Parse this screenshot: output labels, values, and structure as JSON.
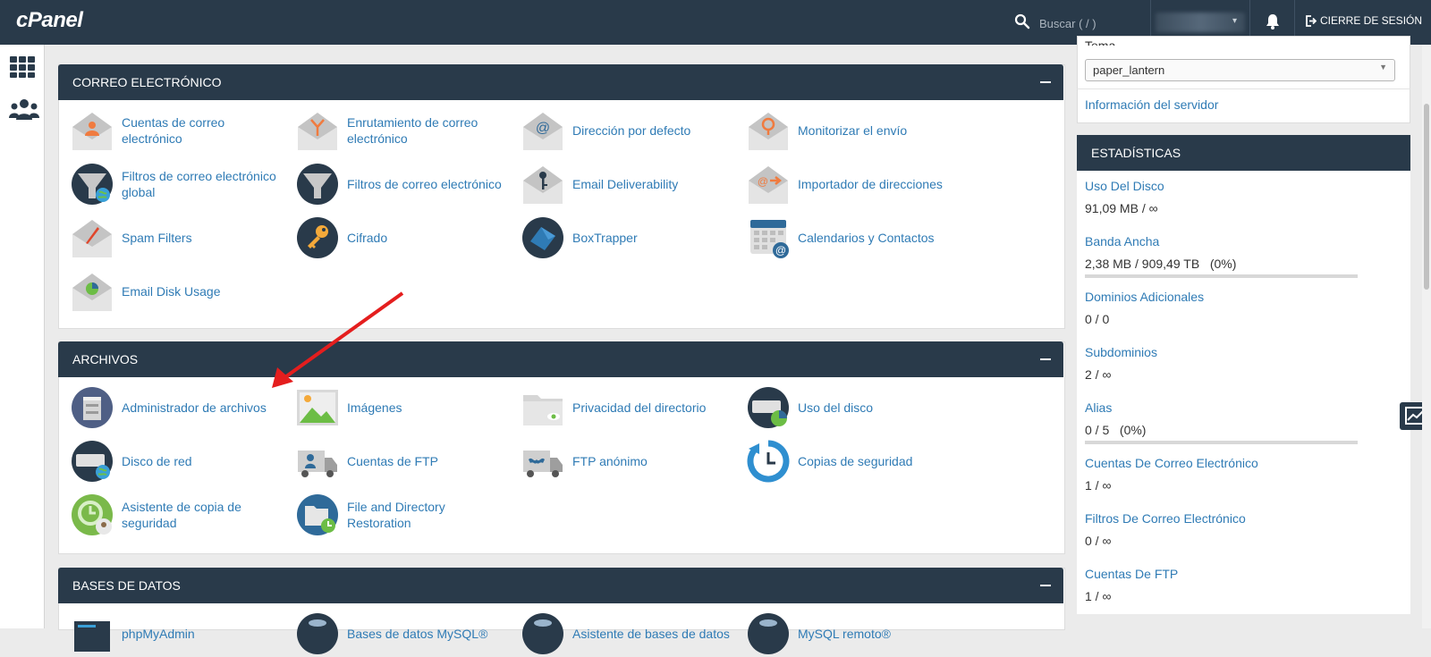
{
  "app": {
    "logo": "cPanel"
  },
  "topbar": {
    "search_placeholder": "Buscar ( / )",
    "logout_label": "CIERRE DE SESIÓN"
  },
  "sections": [
    {
      "title": "CORREO ELECTRÓNICO",
      "items": [
        {
          "label": "Cuentas de correo electrónico",
          "icon": "email-accounts-icon"
        },
        {
          "label": "Enrutamiento de correo electrónico",
          "icon": "email-routing-icon"
        },
        {
          "label": "Dirección por defecto",
          "icon": "default-address-icon"
        },
        {
          "label": "Monitorizar el envío",
          "icon": "track-delivery-icon"
        },
        {
          "label": "Filtros de correo electrónico global",
          "icon": "global-filter-icon"
        },
        {
          "label": "Filtros de correo electrónico",
          "icon": "email-filter-icon"
        },
        {
          "label": "Email Deliverability",
          "icon": "deliverability-icon"
        },
        {
          "label": "Importador de direcciones",
          "icon": "address-importer-icon"
        },
        {
          "label": "Spam Filters",
          "icon": "spam-filter-icon"
        },
        {
          "label": "Cifrado",
          "icon": "encryption-key-icon"
        },
        {
          "label": "BoxTrapper",
          "icon": "boxtrapper-icon"
        },
        {
          "label": "Calendarios y Contactos",
          "icon": "calendar-icon"
        },
        {
          "label": "Email Disk Usage",
          "icon": "email-disk-usage-icon"
        }
      ]
    },
    {
      "title": "ARCHIVOS",
      "items": [
        {
          "label": "Administrador de archivos",
          "icon": "file-manager-icon"
        },
        {
          "label": "Imágenes",
          "icon": "images-icon"
        },
        {
          "label": "Privacidad del directorio",
          "icon": "directory-privacy-icon"
        },
        {
          "label": "Uso del disco",
          "icon": "disk-usage-icon"
        },
        {
          "label": "Disco de red",
          "icon": "network-disk-icon"
        },
        {
          "label": "Cuentas de FTP",
          "icon": "ftp-accounts-icon"
        },
        {
          "label": "FTP anónimo",
          "icon": "anonymous-ftp-icon"
        },
        {
          "label": "Copias de seguridad",
          "icon": "backup-icon"
        },
        {
          "label": "Asistente de copia de seguridad",
          "icon": "backup-wizard-icon"
        },
        {
          "label": "File and Directory Restoration",
          "icon": "restoration-icon"
        }
      ]
    },
    {
      "title": "BASES DE DATOS",
      "items": [
        {
          "label": "phpMyAdmin",
          "icon": "phpmyadmin-icon"
        },
        {
          "label": "Bases de datos MySQL®",
          "icon": "mysql-database-icon"
        },
        {
          "label": "Asistente de bases de datos",
          "icon": "database-wizard-icon"
        },
        {
          "label": "MySQL remoto®",
          "icon": "remote-mysql-icon"
        }
      ]
    }
  ],
  "general": {
    "theme_label": "Tema",
    "theme_value": "paper_lantern",
    "server_info": "Información del servidor"
  },
  "statistics": {
    "title": "ESTADÍSTICAS",
    "items": [
      {
        "name": "Uso Del Disco",
        "value": "91,09 MB / ∞"
      },
      {
        "name": "Banda Ancha",
        "value": "2,38 MB / 909,49 TB   (0%)",
        "usage_fraction": 0
      },
      {
        "name": "Dominios Adicionales",
        "value": "0 / 0"
      },
      {
        "name": "Subdominios",
        "value": "2 / ∞"
      },
      {
        "name": "Alias",
        "value": "0 / 5   (0%)",
        "usage_fraction": 0
      },
      {
        "name": "Cuentas De Correo Electrónico",
        "value": "1 / ∞"
      },
      {
        "name": "Filtros De Correo Electrónico",
        "value": "0 / ∞"
      },
      {
        "name": "Cuentas De FTP",
        "value": "1 / ∞"
      }
    ]
  },
  "colors": {
    "header": "#293a4a",
    "link": "#2f7bb5",
    "arrow": "#e41e1e"
  }
}
